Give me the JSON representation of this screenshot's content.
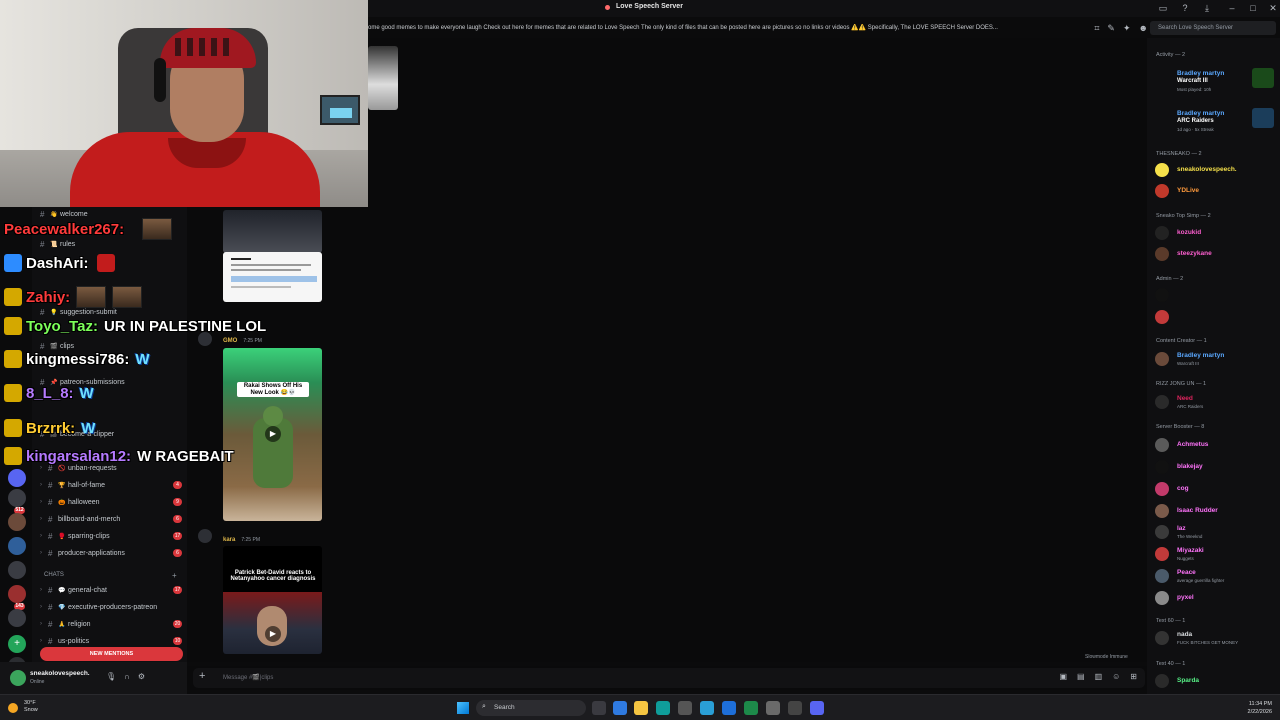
{
  "window": {
    "title": "Love Speech Server",
    "controls": [
      "minimize",
      "maximize",
      "close"
    ]
  },
  "channel_header": {
    "topic": "ome good memes to make everyone laugh Check out here for memes that are related to Love Speech The only kind of files that can be posted here are pictures so no links or videos ⚠️⚠️ Specifically, The LOVE SPEECH Server DOES...",
    "search_placeholder": "Search Love Speech Server"
  },
  "stream_chat": [
    {
      "user": "Peacewalker267:",
      "color": "#ff3b3b",
      "msg": ""
    },
    {
      "user": "DashAri:",
      "color": "#ffffff",
      "msg": ""
    },
    {
      "user": "Zahiy:",
      "color": "#ff3b3b",
      "msg": ""
    },
    {
      "user": "Toyo_Taz:",
      "color": "#7cff5a",
      "msg": "UR IN PALESTINE LOL"
    },
    {
      "user": "kingmessi786:",
      "color": "#ffffff",
      "msg": "",
      "emote": "W"
    },
    {
      "user": "8_L_8:",
      "color": "#b57aff",
      "msg": "",
      "emote": "W"
    },
    {
      "user": "Brzrrk:",
      "color": "#ffcc33",
      "msg": "",
      "emote": "W"
    },
    {
      "user": "kingarsalan12:",
      "color": "#b57aff",
      "msg": "W RAGEBAIT"
    }
  ],
  "channels": [
    {
      "emoji": "👋",
      "name": "welcome",
      "count": ""
    },
    {
      "emoji": "📜",
      "name": "rules",
      "count": ""
    },
    {
      "emoji": "💡",
      "name": "suggestion-submit",
      "count": ""
    },
    {
      "emoji": "🎬",
      "name": "clips",
      "count": ""
    },
    {
      "emoji": "📌",
      "name": "patreon-submissions",
      "count": ""
    },
    {
      "emoji": "🎥",
      "name": "become-a-clipper",
      "count": ""
    },
    {
      "emoji": "🚫",
      "name": "unban-requests",
      "count": ""
    },
    {
      "emoji": "🏆",
      "name": "hall-of-fame",
      "count": "4"
    },
    {
      "emoji": "🎃",
      "name": "halloween",
      "count": "9"
    },
    {
      "emoji": "",
      "name": "billboard-and-merch",
      "count": "6"
    },
    {
      "emoji": "🥊",
      "name": "sparring-clips",
      "count": "17"
    },
    {
      "emoji": "",
      "name": "producer-applications",
      "count": "6"
    },
    {
      "emoji": "💬",
      "name": "general-chat",
      "count": "17"
    },
    {
      "emoji": "💎",
      "name": "executive-producers-patreon",
      "count": ""
    },
    {
      "emoji": "🙏",
      "name": "religion",
      "count": "20"
    },
    {
      "emoji": "",
      "name": "us-politics",
      "count": "10"
    }
  ],
  "channel_section": "CHATS",
  "new_mentions": "NEW MENTIONS",
  "server_badges": [
    "512",
    "143",
    "4",
    "2",
    "239"
  ],
  "messages": [
    {
      "author": "GMO",
      "author_color": "#e0b84a",
      "time": "7:25 PM",
      "caption": "Rakai Shows Off His New Look 😂💀"
    },
    {
      "author": "kara",
      "author_color": "#e0b84a",
      "time": "7:25 PM",
      "caption": "Patrick Bet-David reacts to Netanyahoo cancer diagnosis"
    }
  ],
  "slowmode": "Slowmode Immune",
  "composer": {
    "placeholder": "Message #🎬|clips"
  },
  "user_panel": {
    "name": "sneakolovespeech.",
    "status": "Online"
  },
  "members": {
    "activity_header": "Activity — 2",
    "activity": [
      {
        "name": "Bradley martyn",
        "game": "Warcraft III",
        "sub": "Most played: 10h",
        "color": "#5aa8ff"
      },
      {
        "name": "Bradley martyn",
        "game": "ARC Raiders",
        "sub": "1d ago · 5x Streak",
        "color": "#5aa8ff"
      }
    ],
    "groups": [
      {
        "header": "THESNEAKO — 2",
        "items": [
          {
            "name": "sneakolovespeech.",
            "sub": "",
            "color": "#f5e04a"
          },
          {
            "name": "YDLive",
            "sub": "",
            "color": "#ff9a3c"
          }
        ]
      },
      {
        "header": "Sneako Top Simp — 2",
        "items": [
          {
            "name": "kozukid",
            "sub": "",
            "color": "#ff5fd1"
          },
          {
            "name": "steezykane",
            "sub": "",
            "color": "#ff5fd1"
          }
        ]
      },
      {
        "header": "Admin — 2",
        "items": [
          {
            "name": "",
            "sub": "",
            "color": "#1f3fa8"
          },
          {
            "name": "",
            "sub": "",
            "color": "#1f3fa8"
          }
        ]
      },
      {
        "header": "Content Creator — 1",
        "items": [
          {
            "name": "Bradley martyn",
            "sub": "Warcraft III",
            "color": "#5aa8ff"
          }
        ]
      },
      {
        "header": "RIZZ JONG UN — 1",
        "items": [
          {
            "name": "Need",
            "sub": "ARC Raiders",
            "color": "#e0245e"
          }
        ]
      },
      {
        "header": "Server Booster — 8",
        "items": [
          {
            "name": "Achmetus",
            "sub": "",
            "color": "#ff73fa"
          },
          {
            "name": "blakejay",
            "sub": "",
            "color": "#ff73fa"
          },
          {
            "name": "cog",
            "sub": "",
            "color": "#ff73fa"
          },
          {
            "name": "Isaac Rudder",
            "sub": "",
            "color": "#ff73fa"
          },
          {
            "name": "laz",
            "sub": "The Weeknd",
            "color": "#ff73fa"
          },
          {
            "name": "Miyazaki",
            "sub": "Nuggets",
            "color": "#ff73fa"
          },
          {
            "name": "Peace",
            "sub": "average guerrilla fighter",
            "color": "#ff73fa"
          },
          {
            "name": "pyxel",
            "sub": "",
            "color": "#ff73fa"
          }
        ]
      },
      {
        "header": "Text 60 — 1",
        "items": [
          {
            "name": "nada",
            "sub": "FUCK BITCHES GET MONEY",
            "color": "#dbdee1"
          }
        ]
      },
      {
        "header": "Text 40 — 1",
        "items": [
          {
            "name": "Sparda",
            "sub": "",
            "color": "#57f287"
          }
        ]
      }
    ]
  },
  "taskbar": {
    "weather_temp": "30°F",
    "weather_desc": "Snow",
    "search_label": "Search",
    "time": "11:34 PM",
    "date": "2/22/2026"
  }
}
